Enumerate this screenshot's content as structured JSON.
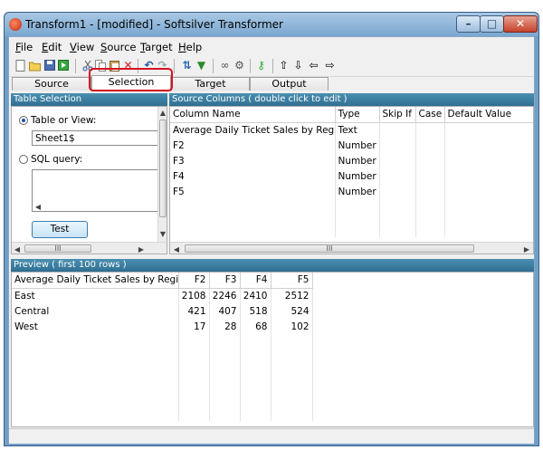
{
  "window": {
    "title": "Transform1 -  [modified] - Softsilver Transformer",
    "minimize": "–",
    "maximize": "□",
    "close": "✕"
  },
  "menu": {
    "file": {
      "key": "F",
      "rest": "ile"
    },
    "edit": {
      "key": "E",
      "rest": "dit"
    },
    "view": {
      "key": "V",
      "rest": "iew"
    },
    "source": {
      "key": "S",
      "rest": "ource"
    },
    "target": {
      "key": "T",
      "rest": "arget"
    },
    "help": {
      "key": "H",
      "rest": "elp"
    }
  },
  "toolbar": {
    "icons": [
      "new-file-icon",
      "open-folder-icon",
      "save-icon",
      "run-icon",
      "cut-icon",
      "copy-icon",
      "paste-icon",
      "delete-icon",
      "undo-icon",
      "redo-icon",
      "sort-icon",
      "filter-icon",
      "link-icon",
      "properties-icon",
      "key-icon",
      "move-up-icon",
      "move-down-icon",
      "move-left-icon",
      "move-right-icon"
    ]
  },
  "tabs": [
    {
      "label": "Source"
    },
    {
      "label": "Selection"
    },
    {
      "label": "Target"
    },
    {
      "label": "Output"
    }
  ],
  "table_selection": {
    "header": "Table Selection",
    "table_or_view_label": "Table or View:",
    "table_or_view_value": "Sheet1$",
    "sql_query_label": "SQL query:",
    "sql_query_value": "",
    "test_button": "Test",
    "scroll_thumb": "III"
  },
  "source_columns": {
    "header": "Source Columns ( double click to edit )",
    "columns": [
      "Column Name",
      "Type",
      "Skip If",
      "Case",
      "Default Value"
    ],
    "rows": [
      {
        "name": "Average Daily Ticket Sales by Regi...",
        "type": "Text"
      },
      {
        "name": "F2",
        "type": "Number"
      },
      {
        "name": "F3",
        "type": "Number"
      },
      {
        "name": "F4",
        "type": "Number"
      },
      {
        "name": "F5",
        "type": "Number"
      }
    ],
    "scroll_thumb": "III"
  },
  "preview": {
    "header": "Preview ( first 100 rows )",
    "columns": [
      "Average Daily Ticket Sales by Region",
      "F2",
      "F3",
      "F4",
      "F5"
    ],
    "rows": [
      [
        "East",
        "2108",
        "2246",
        "2410",
        "2512"
      ],
      [
        "Central",
        "421",
        "407",
        "518",
        "524"
      ],
      [
        "West",
        "17",
        "28",
        "68",
        "102"
      ]
    ]
  },
  "colors": {
    "panel_header": "#3b7ea2",
    "tab_highlight": "#d4121e",
    "titlebar": "#7aa7d0"
  }
}
